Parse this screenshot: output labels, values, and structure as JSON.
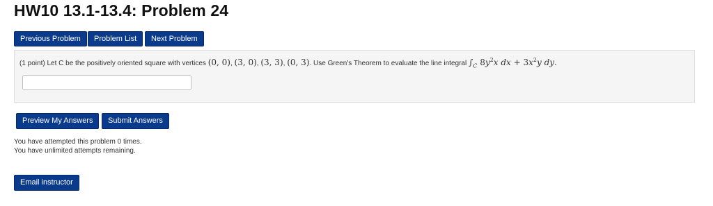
{
  "page": {
    "title": "HW10 13.1-13.4: Problem 24"
  },
  "nav": {
    "previous_label": "Previous Problem",
    "list_label": "Problem List",
    "next_label": "Next Problem"
  },
  "problem": {
    "points": "(1 point)",
    "intro": "Let C be the positively oriented square with vertices",
    "vertices": [
      "(0, 0)",
      "(3, 0)",
      "(3, 3)",
      "(0, 3)"
    ],
    "instruction": "Use Green's Theorem to evaluate the line integral",
    "integral_subscript": "C",
    "answer_value": ""
  },
  "actions": {
    "preview_label": "Preview My Answers",
    "submit_label": "Submit Answers",
    "email_label": "Email instructor"
  },
  "status": {
    "attempted": "You have attempted this problem 0 times.",
    "remaining": "You have unlimited attempts remaining."
  },
  "colors": {
    "button_bg": "#0a3a8c",
    "panel_bg": "#f5f5f5"
  }
}
